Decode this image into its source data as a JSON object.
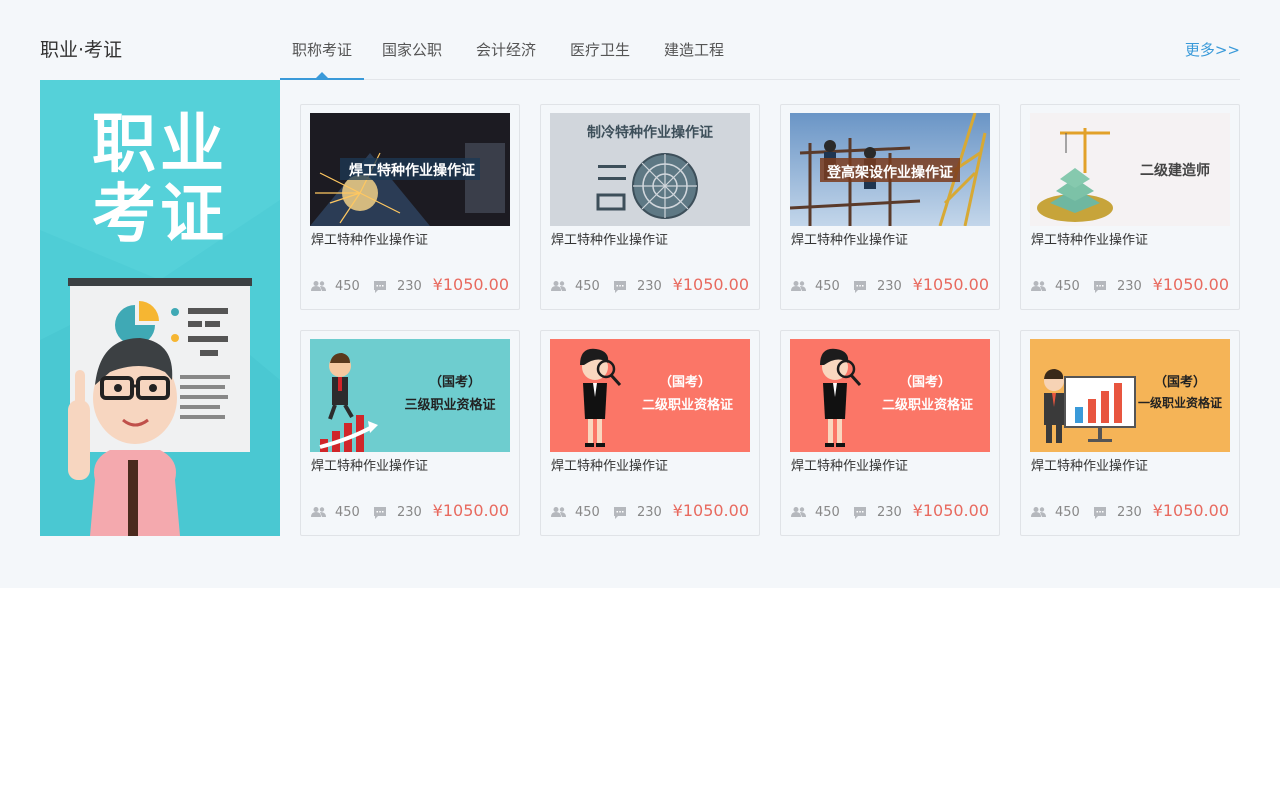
{
  "section": {
    "title": "职业·考证",
    "tabs": [
      "职称考证",
      "国家公职",
      "会计经济",
      "医疗卫生",
      "建造工程"
    ],
    "active_tab": 0,
    "more": "更多>>"
  },
  "banner": {
    "line1": "职业",
    "line2": "考证"
  },
  "courses": [
    {
      "title": "焊工特种作业操作证",
      "thumb_text": "焊工特种作业操作证",
      "students": "450",
      "comments": "230",
      "price": "¥1050.00"
    },
    {
      "title": "焊工特种作业操作证",
      "thumb_text": "制冷特种作业操作证",
      "students": "450",
      "comments": "230",
      "price": "¥1050.00"
    },
    {
      "title": "焊工特种作业操作证",
      "thumb_text": "登高架设作业操作证",
      "students": "450",
      "comments": "230",
      "price": "¥1050.00"
    },
    {
      "title": "焊工特种作业操作证",
      "thumb_text": "二级建造师",
      "students": "450",
      "comments": "230",
      "price": "¥1050.00"
    },
    {
      "title": "焊工特种作业操作证",
      "thumb_text1": "（国考）",
      "thumb_text": "三级职业资格证",
      "students": "450",
      "comments": "230",
      "price": "¥1050.00"
    },
    {
      "title": "焊工特种作业操作证",
      "thumb_text1": "（国考）",
      "thumb_text": "二级职业资格证",
      "students": "450",
      "comments": "230",
      "price": "¥1050.00"
    },
    {
      "title": "焊工特种作业操作证",
      "thumb_text1": "（国考）",
      "thumb_text": "二级职业资格证",
      "students": "450",
      "comments": "230",
      "price": "¥1050.00"
    },
    {
      "title": "焊工特种作业操作证",
      "thumb_text1": "（国考）",
      "thumb_text": "一级职业资格证",
      "students": "450",
      "comments": "230",
      "price": "¥1050.00"
    }
  ],
  "colors": {
    "accent": "#3a9ad9",
    "price": "#e86a5f",
    "banner_bg": "#4fcdd6"
  }
}
